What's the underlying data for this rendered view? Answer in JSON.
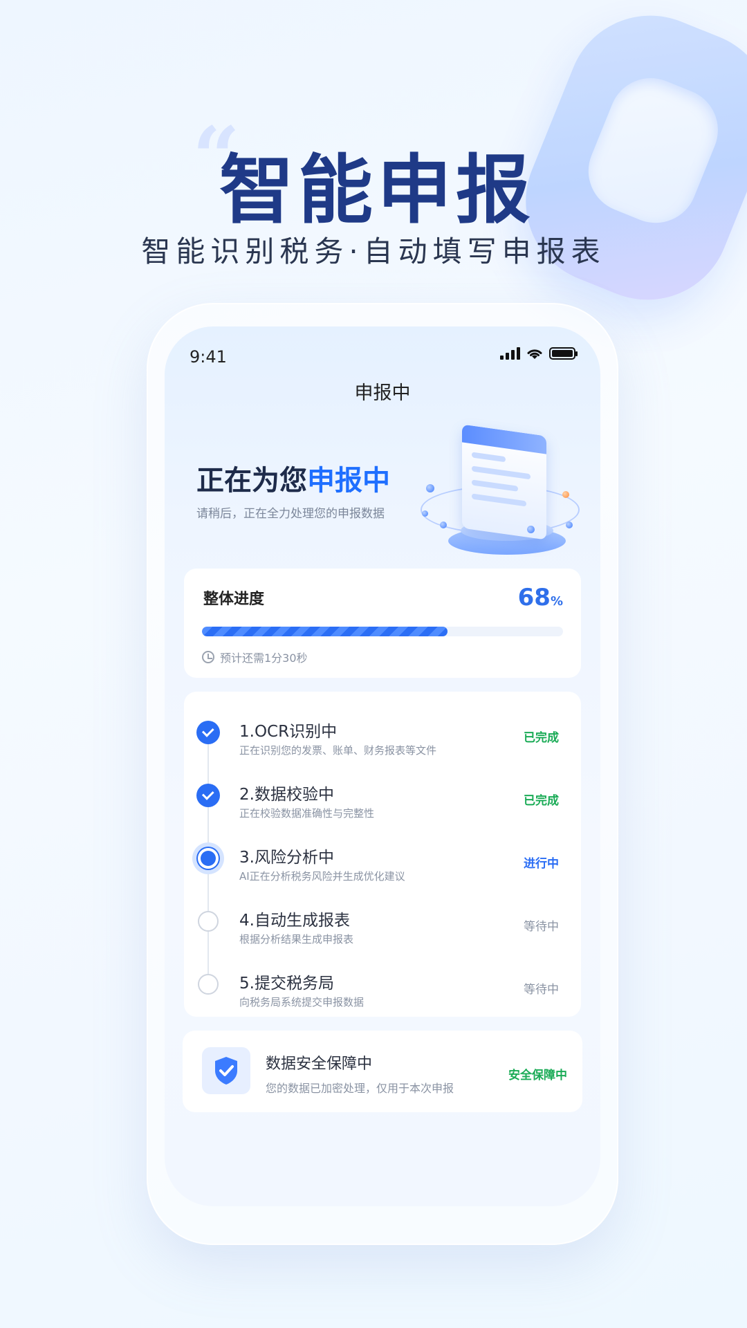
{
  "hero": {
    "title": "智能申报",
    "subtitle": "智能识别税务·自动填写申报表"
  },
  "status_bar": {
    "time": "9:41"
  },
  "nav": {
    "title": "申报中"
  },
  "banner": {
    "headline_prefix": "正在为您",
    "headline_accent": "申报中",
    "subline": "请稍后，正在全力处理您的申报数据"
  },
  "progress": {
    "label": "整体进度",
    "value": 68,
    "unit": "%",
    "eta": "预计还需1分30秒"
  },
  "steps": [
    {
      "title": "1.OCR识别中",
      "desc": "正在识别您的发票、账单、财务报表等文件",
      "status": "已完成",
      "state": "done"
    },
    {
      "title": "2.数据校验中",
      "desc": "正在校验数据准确性与完整性",
      "status": "已完成",
      "state": "done"
    },
    {
      "title": "3.风险分析中",
      "desc": "AI正在分析税务风险并生成优化建议",
      "status": "进行中",
      "state": "active"
    },
    {
      "title": "4.自动生成报表",
      "desc": "根据分析结果生成申报表",
      "status": "等待中",
      "state": "waiting"
    },
    {
      "title": "5.提交税务局",
      "desc": "向税务局系统提交申报数据",
      "status": "等待中",
      "state": "waiting"
    }
  ],
  "security": {
    "title": "数据安全保障中",
    "desc": "您的数据已加密处理，仅用于本次申报",
    "status": "安全保障中",
    "icon": "shield-check-icon"
  },
  "colors": {
    "primary": "#2a6df4",
    "success": "#1aab56",
    "hero_title": "#1f3a87"
  }
}
